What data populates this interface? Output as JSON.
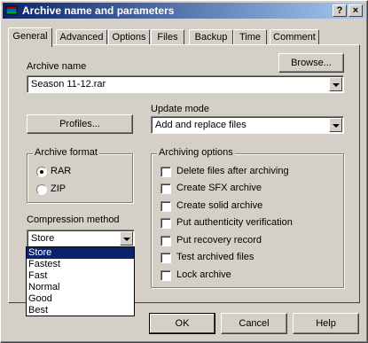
{
  "window": {
    "title": "Archive name and parameters",
    "help_button": "?",
    "close_button": "×",
    "icon": "winrar-books-icon"
  },
  "tabs": [
    {
      "label": "General",
      "active": true
    },
    {
      "label": "Advanced",
      "active": false
    },
    {
      "label": "Options",
      "active": false
    },
    {
      "label": "Files",
      "active": false
    },
    {
      "label": "Backup",
      "active": false
    },
    {
      "label": "Time",
      "active": false
    },
    {
      "label": "Comment",
      "active": false
    }
  ],
  "general": {
    "archive_name_label": "Archive name",
    "browse_button": "Browse...",
    "archive_name_value": "Season 11-12.rar",
    "profiles_button": "Profiles...",
    "update_mode_label": "Update mode",
    "update_mode_value": "Add and replace files",
    "archive_format": {
      "title": "Archive format",
      "options": [
        {
          "label": "RAR",
          "checked": true
        },
        {
          "label": "ZIP",
          "checked": false
        }
      ]
    },
    "compression_method": {
      "label": "Compression method",
      "selected": "Store",
      "options": [
        "Store",
        "Fastest",
        "Fast",
        "Normal",
        "Good",
        "Best"
      ]
    },
    "archiving_options": {
      "title": "Archiving options",
      "items": [
        {
          "label": "Delete files after archiving",
          "checked": false
        },
        {
          "label": "Create SFX archive",
          "checked": false
        },
        {
          "label": "Create solid archive",
          "checked": false
        },
        {
          "label": "Put authenticity verification",
          "checked": false
        },
        {
          "label": "Put recovery record",
          "checked": false
        },
        {
          "label": "Test archived files",
          "checked": false
        },
        {
          "label": "Lock archive",
          "checked": false
        }
      ]
    }
  },
  "footer": {
    "ok": "OK",
    "cancel": "Cancel",
    "help": "Help"
  }
}
